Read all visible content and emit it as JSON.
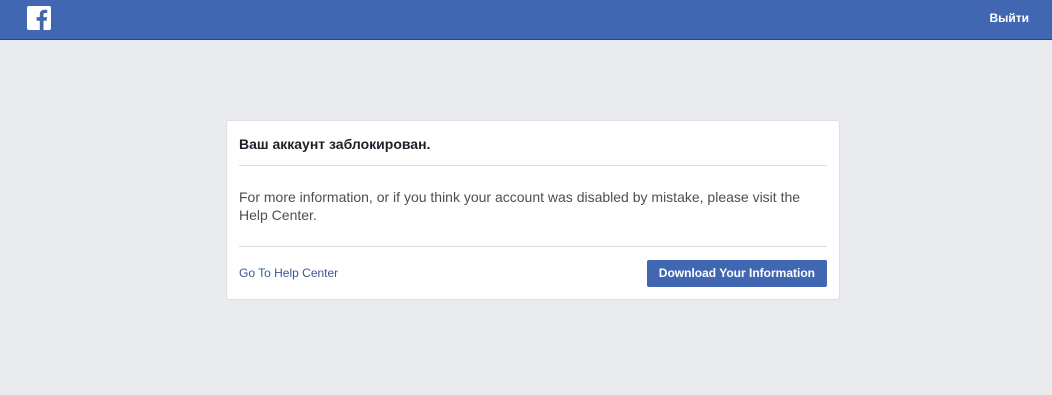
{
  "header": {
    "logo_icon": "facebook-f-icon",
    "logout_label": "Выйти",
    "bar_color": "#4267b2"
  },
  "card": {
    "title": "Ваш аккаунт заблокирован.",
    "message": "For more information, or if you think your account was disabled by mistake, please visit the Help Center.",
    "help_link_label": "Go To Help Center",
    "download_button_label": "Download Your Information"
  },
  "colors": {
    "page_background": "#e9ebee",
    "link": "#365899",
    "button": "#4267b2"
  }
}
